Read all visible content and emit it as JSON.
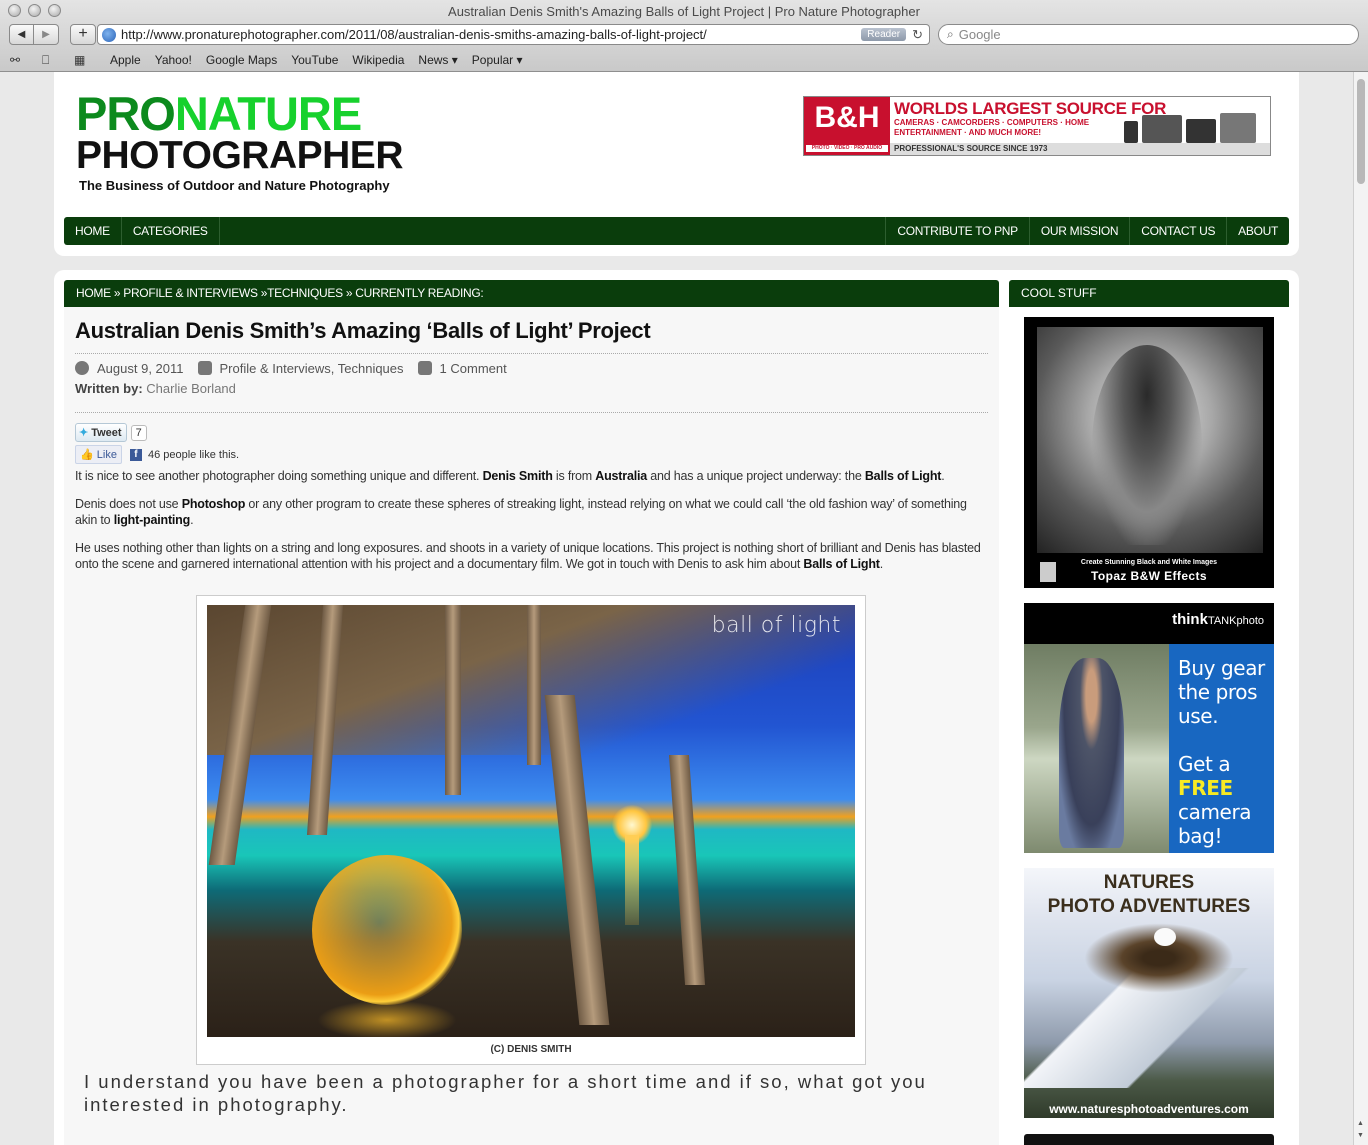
{
  "window": {
    "title": "Australian Denis Smith's Amazing Balls of Light Project | Pro Nature Photographer",
    "url": "http://www.pronaturephotographer.com/2011/08/australian-denis-smiths-amazing-balls-of-light-project/",
    "reader_label": "Reader",
    "search_placeholder": "Google",
    "bookmarks": [
      "Apple",
      "Yahoo!",
      "Google Maps",
      "YouTube",
      "Wikipedia",
      "News ▾",
      "Popular ▾"
    ]
  },
  "logo": {
    "pro": "PRO",
    "nature": "NATURE",
    "photographer": "PHOTOGRAPHER",
    "tagline": "The Business of Outdoor and Nature Photography"
  },
  "bh_ad": {
    "logo": "B&H",
    "logo_small": "PHOTO · VIDEO · PRO AUDIO",
    "headline": "WORLDS LARGEST SOURCE FOR",
    "sub1": "CAMERAS · CAMCORDERS · COMPUTERS · HOME",
    "sub2": "ENTERTAINMENT · AND MUCH MORE!",
    "footer": "PROFESSIONAL'S SOURCE SINCE 1973"
  },
  "nav": {
    "left": [
      "HOME",
      "CATEGORIES"
    ],
    "right": [
      "CONTRIBUTE TO PNP",
      "OUR MISSION",
      "CONTACT US",
      "ABOUT"
    ]
  },
  "breadcrumb": "HOME » PROFILE & INTERVIEWS »TECHNIQUES » CURRENTLY READING:",
  "article": {
    "title": "Australian Denis Smith’s Amazing ‘Balls of Light’ Project",
    "date": "August 9, 2011",
    "categories": "Profile & Interviews, Techniques",
    "comments": "1 Comment",
    "written_by_label": "Written by:",
    "author": "Charlie Borland",
    "tweet_label": "Tweet",
    "tweet_count": "7",
    "like_label": "Like",
    "like_text": "46 people like this.",
    "p1": {
      "a": "It is nice to see another photographer doing something unique and different. ",
      "b": "Denis Smith",
      "c": " is from ",
      "d": "Australia",
      "e": " and has a unique project underway: the ",
      "f": "Balls of Light",
      "g": "."
    },
    "p2": {
      "a": "Denis does not use ",
      "b": "Photoshop",
      "c": " or any other program to create these spheres of streaking light, instead relying on what we could call ‘the old fashion way’ of something akin to ",
      "d": "light-painting",
      "e": "."
    },
    "p3": {
      "a": "He uses nothing other than lights on a string and long exposures. and shoots in a variety of unique locations. This project is nothing short of brilliant and Denis has blasted onto the scene and garnered international attention with his project and a documentary film. We got in touch with Denis to ask him about ",
      "b": "Balls of Light",
      "c": "."
    },
    "image_watermark": "ball of light",
    "caption": "(C) DENIS SMITH",
    "question": "I understand you have been a photographer for a short time and if so, what got you interested in photography."
  },
  "sidebar": {
    "heading": "COOL STUFF",
    "ad1_small": "Create Stunning Black and White Images",
    "ad1_big": "Topaz B&W Effects",
    "ad2_logo_bold": "think",
    "ad2_logo_tank": "TANK",
    "ad2_logo_photo": "photo",
    "ad2_line1": "Buy gear",
    "ad2_line2": "the pros",
    "ad2_line3": "use.",
    "ad2_line4": "Get a",
    "ad2_free": "FREE",
    "ad2_line5": "camera",
    "ad2_line6": "bag!",
    "ad3_title1": "NATURES",
    "ad3_title2": "PHOTO ADVENTURES",
    "ad3_url": "www.naturesphotoadventures.com"
  }
}
